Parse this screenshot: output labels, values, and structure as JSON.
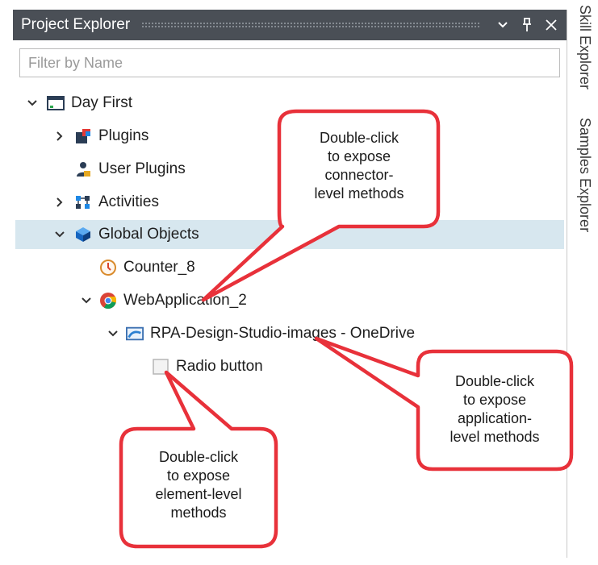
{
  "panel": {
    "title": "Project Explorer"
  },
  "filter": {
    "placeholder": "Filter by Name",
    "value": ""
  },
  "tree": {
    "root": "Day First",
    "plugins": "Plugins",
    "user_plugins": "User Plugins",
    "activities": "Activities",
    "global_objects": "Global Objects",
    "counter": "Counter_8",
    "web_app": "WebApplication_2",
    "onedrive": "RPA-Design-Studio-images - OneDrive",
    "radio": "Radio button"
  },
  "side_tabs": {
    "skill": "Skill Explorer",
    "samples": "Samples Explorer"
  },
  "callouts": {
    "connector": [
      "Double-click",
      "to expose",
      "connector-",
      "level methods"
    ],
    "application": [
      "Double-click",
      "to expose",
      "application-",
      "level methods"
    ],
    "element": [
      "Double-click",
      "to expose",
      "element-level",
      "methods"
    ]
  },
  "colors": {
    "titlebar": "#4a4f56",
    "selected_row": "#d7e7ef",
    "callout_border": "#e8313a"
  },
  "icons": [
    "window-icon",
    "puzzle-icon",
    "user-icon",
    "activities-icon",
    "cube-icon",
    "counter-icon",
    "chrome-icon",
    "browser-window-icon",
    "radio-button-icon",
    "chevron-down-icon",
    "chevron-right-icon",
    "pin-icon",
    "close-icon"
  ]
}
